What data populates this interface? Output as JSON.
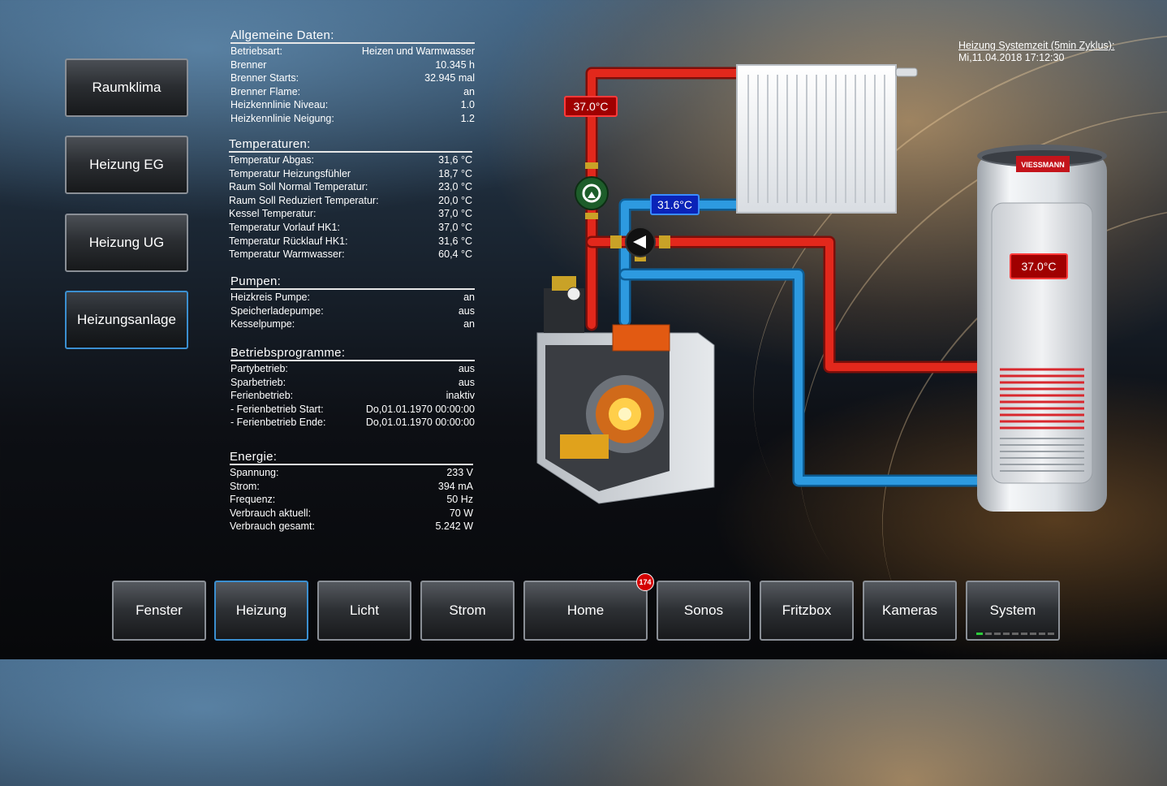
{
  "sidebar": {
    "items": [
      {
        "label": "Raumklima"
      },
      {
        "label": "Heizung EG"
      },
      {
        "label": "Heizung UG"
      },
      {
        "label": "Heizungsanlage"
      }
    ]
  },
  "system_time": {
    "title": "Heizung Systemzeit (5min Zyklus):",
    "value": "Mi,11.04.2018 17:12:30"
  },
  "general": {
    "title": "Allgemeine Daten:",
    "rows": [
      {
        "label": "Betriebsart:",
        "value": "Heizen und Warmwasser"
      },
      {
        "label": "Brenner",
        "value": "10.345 h"
      },
      {
        "label": "Brenner Starts:",
        "value": "32.945 mal"
      },
      {
        "label": "Brenner Flame:",
        "value": "an"
      },
      {
        "label": "Heizkennlinie Niveau:",
        "value": "1.0"
      },
      {
        "label": "Heizkennlinie Neigung:",
        "value": "1.2"
      }
    ]
  },
  "temperatures": {
    "title": "Temperaturen:",
    "rows": [
      {
        "label": "Temperatur Abgas:",
        "value": "31,6 °C"
      },
      {
        "label": "Temperatur Heizungsfühler",
        "value": "18,7 °C"
      },
      {
        "label": "Raum Soll Normal Temperatur:",
        "value": "23,0 °C"
      },
      {
        "label": "Raum Soll Reduziert Temperatur:",
        "value": "20,0 °C"
      },
      {
        "label": "Kessel Temperatur:",
        "value": "37,0 °C"
      },
      {
        "label": "Temperatur Vorlauf HK1:",
        "value": "37,0 °C"
      },
      {
        "label": "Temperatur Rücklauf HK1:",
        "value": "31,6 °C"
      },
      {
        "label": "Temperatur Warmwasser:",
        "value": "60,4 °C"
      }
    ]
  },
  "pumps": {
    "title": "Pumpen:",
    "rows": [
      {
        "label": "Heizkreis Pumpe:",
        "value": "an"
      },
      {
        "label": "Speicherladepumpe:",
        "value": "aus"
      },
      {
        "label": "Kesselpumpe:",
        "value": "an"
      }
    ]
  },
  "programs": {
    "title": "Betriebsprogramme:",
    "rows": [
      {
        "label": "Partybetrieb:",
        "value": "aus"
      },
      {
        "label": "Sparbetrieb:",
        "value": "aus"
      },
      {
        "label": "Ferienbetrieb:",
        "value": "inaktiv"
      },
      {
        "label": "- Ferienbetrieb Start:",
        "value": "Do,01.01.1970 00:00:00"
      },
      {
        "label": "- Ferienbetrieb Ende:",
        "value": "Do,01.01.1970 00:00:00"
      }
    ]
  },
  "energy": {
    "title": "Energie:",
    "rows": [
      {
        "label": "Spannung:",
        "value": "233 V"
      },
      {
        "label": "Strom:",
        "value": "394 mA"
      },
      {
        "label": "Frequenz:",
        "value": "50 Hz"
      },
      {
        "label": "Verbrauch aktuell:",
        "value": "70 W"
      },
      {
        "label": "Verbrauch gesamt:",
        "value": "5.242 W"
      }
    ]
  },
  "diagram": {
    "supply_temp": "37.0°C",
    "return_temp": "31.6°C",
    "tank_temp": "37.0°C",
    "brand": "VIESSMANN",
    "boiler_brand": "VIESSMANN",
    "colors": {
      "supply": "#d8261b",
      "return": "#1e8fd6"
    }
  },
  "bottom_nav": {
    "items": [
      {
        "label": "Fenster"
      },
      {
        "label": "Heizung"
      },
      {
        "label": "Licht"
      },
      {
        "label": "Strom"
      },
      {
        "label": "Home"
      },
      {
        "label": "Sonos"
      },
      {
        "label": "Fritzbox"
      },
      {
        "label": "Kameras"
      },
      {
        "label": "System"
      }
    ],
    "home_badge": "174"
  },
  "icons": [
    "pump-icon",
    "mixing-valve-icon",
    "radiator-icon",
    "boiler-icon",
    "storage-tank-icon"
  ]
}
